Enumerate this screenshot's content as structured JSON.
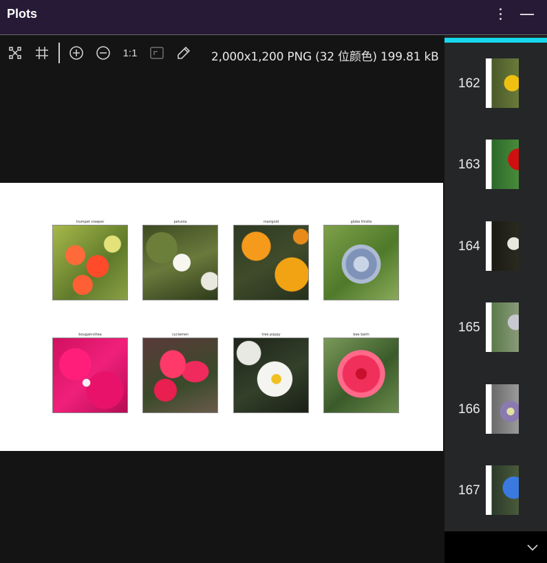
{
  "window": {
    "title": "Plots"
  },
  "toolbar": {
    "zoom_reset_label": "1:1",
    "image_info": "2,000x1,200 PNG (32 位颜色) 199.81 kB"
  },
  "plot": {
    "tiles": [
      {
        "label": "trumpet creeper"
      },
      {
        "label": "petunia"
      },
      {
        "label": "marigold"
      },
      {
        "label": "globe thistle"
      },
      {
        "label": "bougainvillea"
      },
      {
        "label": "cyclamen"
      },
      {
        "label": "tree poppy"
      },
      {
        "label": "bee balm"
      }
    ]
  },
  "sidebar": {
    "items": [
      {
        "number": "162"
      },
      {
        "number": "163"
      },
      {
        "number": "164"
      },
      {
        "number": "165"
      },
      {
        "number": "166"
      },
      {
        "number": "167"
      }
    ]
  },
  "colors": {
    "titlebar": "#261a36",
    "accent": "#16d9ee",
    "sidebar": "#252628"
  }
}
